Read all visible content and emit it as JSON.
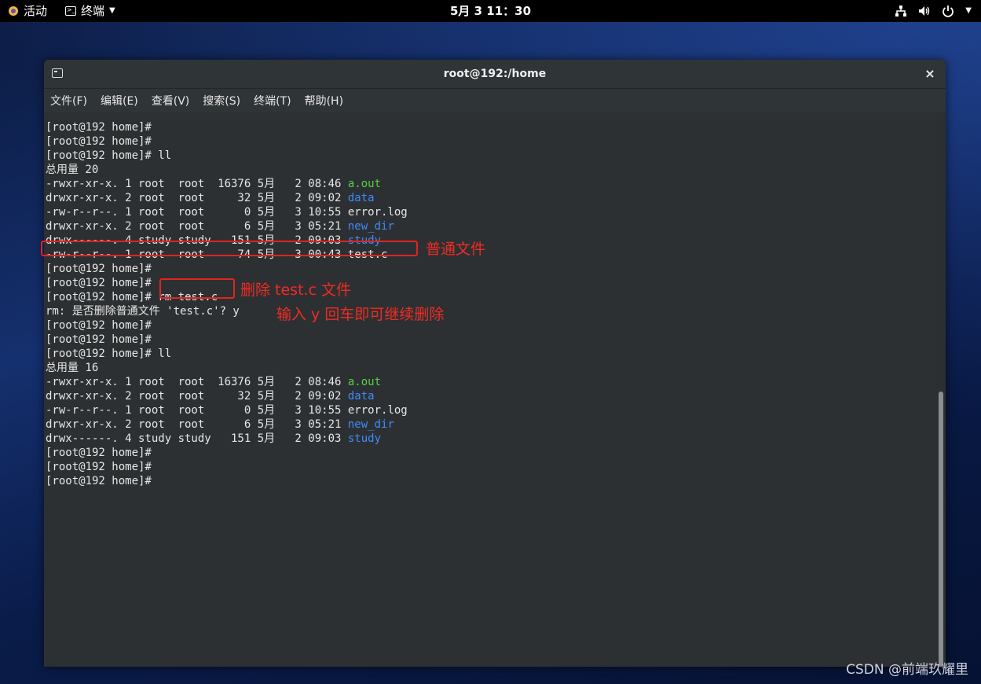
{
  "topbar": {
    "activities": "活动",
    "app_menu": "终端",
    "clock": "5月 3 11：30"
  },
  "window": {
    "title": "root@192:/home",
    "close": "×",
    "menu": [
      "文件(F)",
      "编辑(E)",
      "查看(V)",
      "搜索(S)",
      "终端(T)",
      "帮助(H)"
    ]
  },
  "terminal": {
    "lines": [
      {
        "text": "[root@192 home]#"
      },
      {
        "text": "[root@192 home]#"
      },
      {
        "text": "[root@192 home]# ll"
      },
      {
        "text": "总用量 20"
      },
      {
        "text": "-rwxr-xr-x. 1 root  root  16376 5月   2 08:46 ",
        "name": "a.out",
        "color": "green"
      },
      {
        "text": "drwxr-xr-x. 2 root  root     32 5月   2 09:02 ",
        "name": "data",
        "color": "blue"
      },
      {
        "text": "-rw-r--r--. 1 root  root      0 5月   3 10:55 ",
        "name": "error.log",
        "color": "plain"
      },
      {
        "text": "drwxr-xr-x. 2 root  root      6 5月   3 05:21 ",
        "name": "new_dir",
        "color": "blue"
      },
      {
        "text": "drwx------. 4 study study   151 5月   2 09:03 ",
        "name": "study",
        "color": "blue"
      },
      {
        "text": "-rw-r--r--. 1 root  root     74 5月   3 00:43 ",
        "name": "test.c",
        "color": "plain"
      },
      {
        "text": "[root@192 home]#"
      },
      {
        "text": "[root@192 home]#"
      },
      {
        "text": "[root@192 home]# rm test.c"
      },
      {
        "text": "rm: 是否删除普通文件 'test.c'? y"
      },
      {
        "text": "[root@192 home]#"
      },
      {
        "text": "[root@192 home]#"
      },
      {
        "text": "[root@192 home]# ll"
      },
      {
        "text": "总用量 16"
      },
      {
        "text": "-rwxr-xr-x. 1 root  root  16376 5月   2 08:46 ",
        "name": "a.out",
        "color": "green"
      },
      {
        "text": "drwxr-xr-x. 2 root  root     32 5月   2 09:02 ",
        "name": "data",
        "color": "blue"
      },
      {
        "text": "-rw-r--r--. 1 root  root      0 5月   3 10:55 ",
        "name": "error.log",
        "color": "plain"
      },
      {
        "text": "drwxr-xr-x. 2 root  root      6 5月   3 05:21 ",
        "name": "new_dir",
        "color": "blue"
      },
      {
        "text": "drwx------. 4 study study   151 5月   2 09:03 ",
        "name": "study",
        "color": "blue"
      },
      {
        "text": "[root@192 home]#"
      },
      {
        "text": "[root@192 home]#"
      },
      {
        "text": "[root@192 home]#"
      }
    ]
  },
  "annotations": {
    "regular_file": "普通文件",
    "delete_cmd": "删除 test.c 文件",
    "confirm_hint": "输入 y 回车即可继续删除"
  },
  "watermark": "CSDN @前端玖耀里",
  "colors": {
    "accent_red": "#e0241f",
    "exec_green": "#54d244",
    "dir_blue": "#3c8cff"
  }
}
